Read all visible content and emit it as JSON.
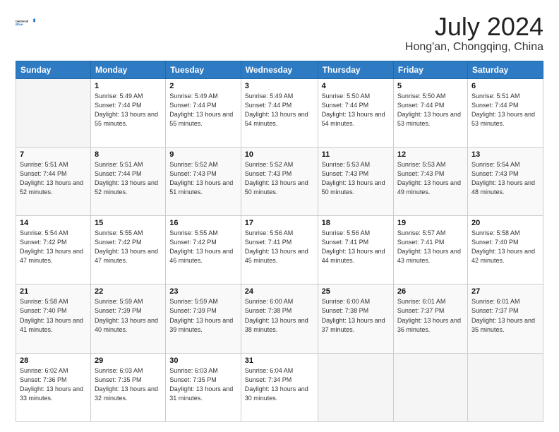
{
  "header": {
    "logo_line1": "General",
    "logo_line2": "Blue",
    "month": "July 2024",
    "location": "Hong'an, Chongqing, China"
  },
  "days_of_week": [
    "Sunday",
    "Monday",
    "Tuesday",
    "Wednesday",
    "Thursday",
    "Friday",
    "Saturday"
  ],
  "weeks": [
    [
      {
        "day": "",
        "sunrise": "",
        "sunset": "",
        "daylight": ""
      },
      {
        "day": "1",
        "sunrise": "Sunrise: 5:49 AM",
        "sunset": "Sunset: 7:44 PM",
        "daylight": "Daylight: 13 hours and 55 minutes."
      },
      {
        "day": "2",
        "sunrise": "Sunrise: 5:49 AM",
        "sunset": "Sunset: 7:44 PM",
        "daylight": "Daylight: 13 hours and 55 minutes."
      },
      {
        "day": "3",
        "sunrise": "Sunrise: 5:49 AM",
        "sunset": "Sunset: 7:44 PM",
        "daylight": "Daylight: 13 hours and 54 minutes."
      },
      {
        "day": "4",
        "sunrise": "Sunrise: 5:50 AM",
        "sunset": "Sunset: 7:44 PM",
        "daylight": "Daylight: 13 hours and 54 minutes."
      },
      {
        "day": "5",
        "sunrise": "Sunrise: 5:50 AM",
        "sunset": "Sunset: 7:44 PM",
        "daylight": "Daylight: 13 hours and 53 minutes."
      },
      {
        "day": "6",
        "sunrise": "Sunrise: 5:51 AM",
        "sunset": "Sunset: 7:44 PM",
        "daylight": "Daylight: 13 hours and 53 minutes."
      }
    ],
    [
      {
        "day": "7",
        "sunrise": "Sunrise: 5:51 AM",
        "sunset": "Sunset: 7:44 PM",
        "daylight": "Daylight: 13 hours and 52 minutes."
      },
      {
        "day": "8",
        "sunrise": "Sunrise: 5:51 AM",
        "sunset": "Sunset: 7:44 PM",
        "daylight": "Daylight: 13 hours and 52 minutes."
      },
      {
        "day": "9",
        "sunrise": "Sunrise: 5:52 AM",
        "sunset": "Sunset: 7:43 PM",
        "daylight": "Daylight: 13 hours and 51 minutes."
      },
      {
        "day": "10",
        "sunrise": "Sunrise: 5:52 AM",
        "sunset": "Sunset: 7:43 PM",
        "daylight": "Daylight: 13 hours and 50 minutes."
      },
      {
        "day": "11",
        "sunrise": "Sunrise: 5:53 AM",
        "sunset": "Sunset: 7:43 PM",
        "daylight": "Daylight: 13 hours and 50 minutes."
      },
      {
        "day": "12",
        "sunrise": "Sunrise: 5:53 AM",
        "sunset": "Sunset: 7:43 PM",
        "daylight": "Daylight: 13 hours and 49 minutes."
      },
      {
        "day": "13",
        "sunrise": "Sunrise: 5:54 AM",
        "sunset": "Sunset: 7:43 PM",
        "daylight": "Daylight: 13 hours and 48 minutes."
      }
    ],
    [
      {
        "day": "14",
        "sunrise": "Sunrise: 5:54 AM",
        "sunset": "Sunset: 7:42 PM",
        "daylight": "Daylight: 13 hours and 47 minutes."
      },
      {
        "day": "15",
        "sunrise": "Sunrise: 5:55 AM",
        "sunset": "Sunset: 7:42 PM",
        "daylight": "Daylight: 13 hours and 47 minutes."
      },
      {
        "day": "16",
        "sunrise": "Sunrise: 5:55 AM",
        "sunset": "Sunset: 7:42 PM",
        "daylight": "Daylight: 13 hours and 46 minutes."
      },
      {
        "day": "17",
        "sunrise": "Sunrise: 5:56 AM",
        "sunset": "Sunset: 7:41 PM",
        "daylight": "Daylight: 13 hours and 45 minutes."
      },
      {
        "day": "18",
        "sunrise": "Sunrise: 5:56 AM",
        "sunset": "Sunset: 7:41 PM",
        "daylight": "Daylight: 13 hours and 44 minutes."
      },
      {
        "day": "19",
        "sunrise": "Sunrise: 5:57 AM",
        "sunset": "Sunset: 7:41 PM",
        "daylight": "Daylight: 13 hours and 43 minutes."
      },
      {
        "day": "20",
        "sunrise": "Sunrise: 5:58 AM",
        "sunset": "Sunset: 7:40 PM",
        "daylight": "Daylight: 13 hours and 42 minutes."
      }
    ],
    [
      {
        "day": "21",
        "sunrise": "Sunrise: 5:58 AM",
        "sunset": "Sunset: 7:40 PM",
        "daylight": "Daylight: 13 hours and 41 minutes."
      },
      {
        "day": "22",
        "sunrise": "Sunrise: 5:59 AM",
        "sunset": "Sunset: 7:39 PM",
        "daylight": "Daylight: 13 hours and 40 minutes."
      },
      {
        "day": "23",
        "sunrise": "Sunrise: 5:59 AM",
        "sunset": "Sunset: 7:39 PM",
        "daylight": "Daylight: 13 hours and 39 minutes."
      },
      {
        "day": "24",
        "sunrise": "Sunrise: 6:00 AM",
        "sunset": "Sunset: 7:38 PM",
        "daylight": "Daylight: 13 hours and 38 minutes."
      },
      {
        "day": "25",
        "sunrise": "Sunrise: 6:00 AM",
        "sunset": "Sunset: 7:38 PM",
        "daylight": "Daylight: 13 hours and 37 minutes."
      },
      {
        "day": "26",
        "sunrise": "Sunrise: 6:01 AM",
        "sunset": "Sunset: 7:37 PM",
        "daylight": "Daylight: 13 hours and 36 minutes."
      },
      {
        "day": "27",
        "sunrise": "Sunrise: 6:01 AM",
        "sunset": "Sunset: 7:37 PM",
        "daylight": "Daylight: 13 hours and 35 minutes."
      }
    ],
    [
      {
        "day": "28",
        "sunrise": "Sunrise: 6:02 AM",
        "sunset": "Sunset: 7:36 PM",
        "daylight": "Daylight: 13 hours and 33 minutes."
      },
      {
        "day": "29",
        "sunrise": "Sunrise: 6:03 AM",
        "sunset": "Sunset: 7:35 PM",
        "daylight": "Daylight: 13 hours and 32 minutes."
      },
      {
        "day": "30",
        "sunrise": "Sunrise: 6:03 AM",
        "sunset": "Sunset: 7:35 PM",
        "daylight": "Daylight: 13 hours and 31 minutes."
      },
      {
        "day": "31",
        "sunrise": "Sunrise: 6:04 AM",
        "sunset": "Sunset: 7:34 PM",
        "daylight": "Daylight: 13 hours and 30 minutes."
      },
      {
        "day": "",
        "sunrise": "",
        "sunset": "",
        "daylight": ""
      },
      {
        "day": "",
        "sunrise": "",
        "sunset": "",
        "daylight": ""
      },
      {
        "day": "",
        "sunrise": "",
        "sunset": "",
        "daylight": ""
      }
    ]
  ]
}
